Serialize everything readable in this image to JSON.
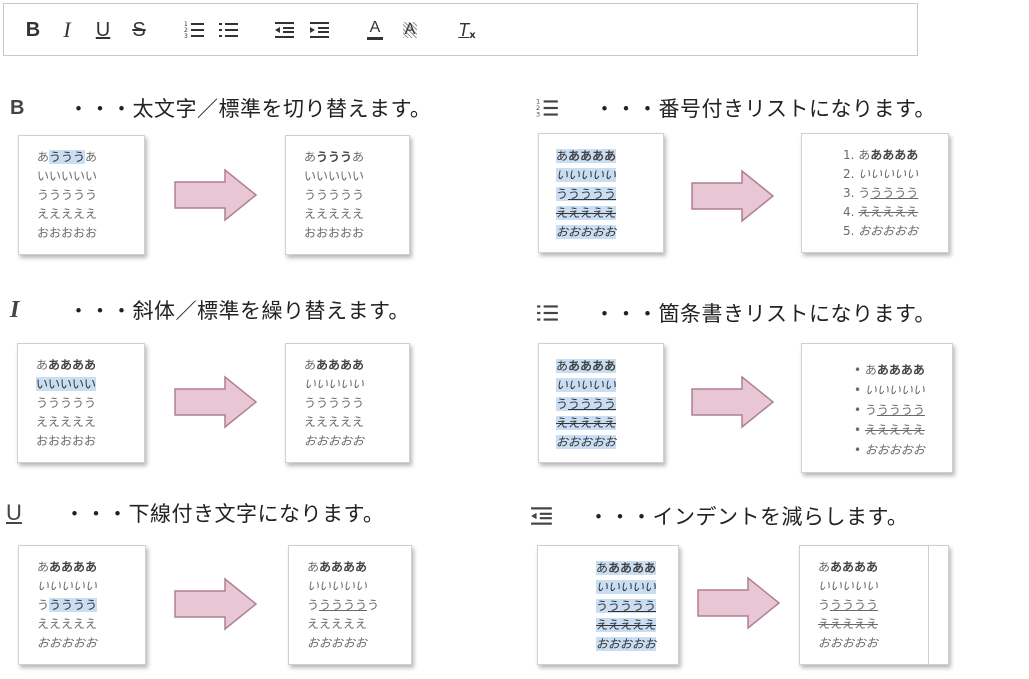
{
  "toolbar": {
    "buttons": [
      {
        "name": "bold",
        "glyph": "B"
      },
      {
        "name": "italic",
        "glyph": "I"
      },
      {
        "name": "underline",
        "glyph": "U"
      },
      {
        "name": "strikethrough",
        "glyph": "S"
      },
      {
        "name": "numbered-list"
      },
      {
        "name": "bulleted-list"
      },
      {
        "name": "outdent"
      },
      {
        "name": "indent"
      },
      {
        "name": "text-color",
        "glyph": "A"
      },
      {
        "name": "background-color",
        "glyph": "A"
      },
      {
        "name": "remove-format",
        "glyph": "T"
      }
    ]
  },
  "sections": {
    "bold": {
      "icon": "B",
      "text": "・・・太文字／標準を切り替えます。"
    },
    "italic": {
      "icon": "I",
      "text": "・・・斜体／標準を繰り替えます。"
    },
    "underline": {
      "icon": "U",
      "text": "・・・下線付き文字になります。"
    },
    "numbered": {
      "text": "・・・番号付きリストになります。"
    },
    "bulleted": {
      "text": "・・・箇条書きリストになります。"
    },
    "outdent": {
      "text": "・・・インデントを減らします。"
    }
  },
  "samples": {
    "a_first": "あ",
    "a_rest": "ああああ",
    "a_all": "あああああ",
    "i_all": "いいいいい",
    "u_first": "う",
    "u_mid": "うううう",
    "u_mid3": "ううう",
    "u_last": "う",
    "u_all": "ううううう",
    "e_all": "えええええ",
    "o_all": "おおおおお",
    "n1": "1.",
    "n2": "2.",
    "n3": "3.",
    "n4": "4.",
    "n5": "5.",
    "bullet": "•"
  },
  "colors": {
    "highlight": "#c9def3",
    "arrow_fill": "#e9c6d4",
    "arrow_stroke": "#b07f94"
  }
}
